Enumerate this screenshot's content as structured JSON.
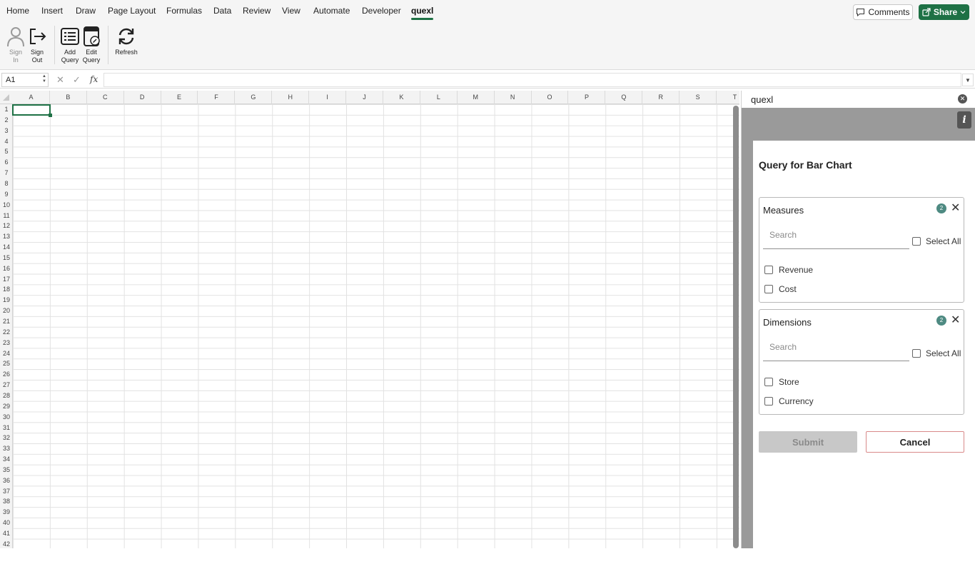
{
  "ribbon_tabs": [
    "Home",
    "Insert",
    "Draw",
    "Page Layout",
    "Formulas",
    "Data",
    "Review",
    "View",
    "Automate",
    "Developer",
    "quexl"
  ],
  "active_tab": "quexl",
  "header_actions": {
    "comments_label": "Comments",
    "share_label": "Share"
  },
  "ribbon_buttons": {
    "sign_in": {
      "line1": "Sign",
      "line2": "In"
    },
    "sign_out": {
      "line1": "Sign",
      "line2": "Out"
    },
    "add_query": {
      "line1": "Add",
      "line2": "Query"
    },
    "edit_query": {
      "line1": "Edit",
      "line2": "Query"
    },
    "refresh": {
      "line1": "Refresh"
    }
  },
  "formula_bar": {
    "name_box": "A1",
    "fx": "fx",
    "value": ""
  },
  "sheet": {
    "columns": [
      "A",
      "B",
      "C",
      "D",
      "E",
      "F",
      "G",
      "H",
      "I",
      "J",
      "K",
      "L",
      "M",
      "N",
      "O",
      "P",
      "Q",
      "R",
      "S",
      "T"
    ],
    "rows": [
      "1",
      "2",
      "3",
      "4",
      "5",
      "6",
      "7",
      "8",
      "9",
      "10",
      "11",
      "12",
      "13",
      "14",
      "15",
      "16",
      "17",
      "18",
      "19",
      "20",
      "21",
      "22",
      "23",
      "24",
      "25",
      "26",
      "27",
      "28",
      "29",
      "30",
      "31",
      "32",
      "33",
      "34",
      "35",
      "36",
      "37",
      "38",
      "39",
      "40",
      "41",
      "42"
    ],
    "selected_cell": "A1"
  },
  "task_pane": {
    "title": "quexl",
    "info_icon": "i",
    "form_title": "Query for Bar Chart",
    "measures": {
      "title": "Measures",
      "count": "2",
      "search_placeholder": "Search",
      "select_all_label": "Select All",
      "items": [
        "Revenue",
        "Cost"
      ]
    },
    "dimensions": {
      "title": "Dimensions",
      "count": "2",
      "search_placeholder": "Search",
      "select_all_label": "Select All",
      "items": [
        "Store",
        "Currency"
      ]
    },
    "submit_label": "Submit",
    "cancel_label": "Cancel"
  },
  "colors": {
    "accent": "#1e7145",
    "badge": "#4e8a82",
    "cancel_border": "#d98a8a"
  }
}
